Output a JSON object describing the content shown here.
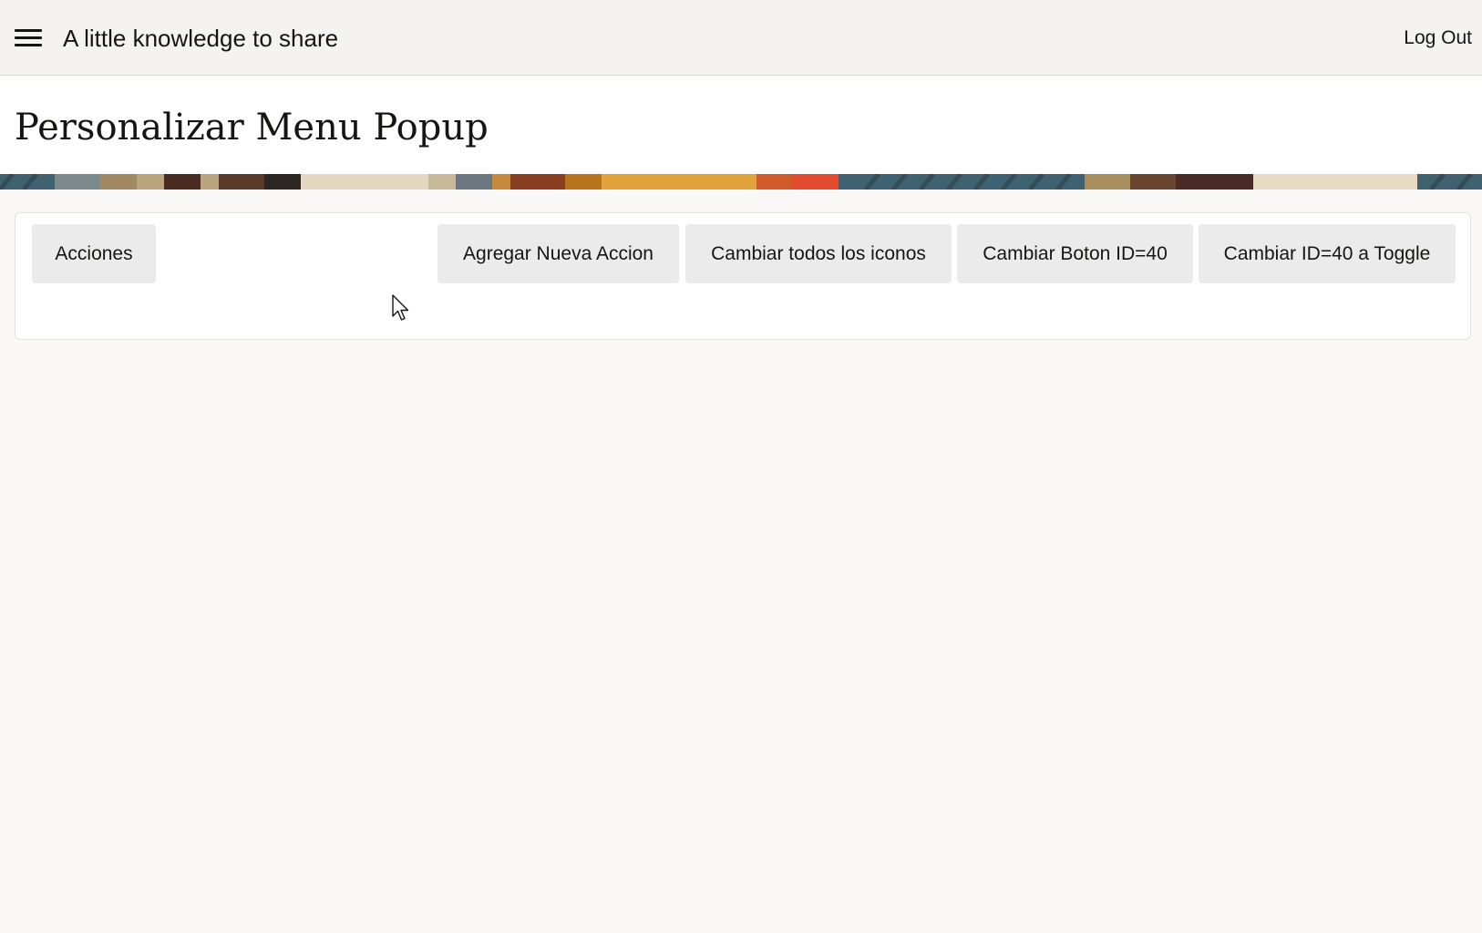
{
  "header": {
    "app_title": "A little knowledge to share",
    "logout_label": "Log Out",
    "menu_icon": "hamburger-menu-icon"
  },
  "page": {
    "title": "Personalizar Menu Popup"
  },
  "toolbar": {
    "acciones_label": "Acciones",
    "agregar_label": "Agregar Nueva Accion",
    "cambiar_iconos_label": "Cambiar todos los iconos",
    "cambiar_boton_label": "Cambiar Boton ID=40",
    "toggle_label": "Cambiar ID=40 a Toggle"
  },
  "colors": {
    "topbar_bg": "#f4f3f1",
    "page_bg": "#f9f8f6",
    "button_bg": "#ebebeb",
    "text": "#161513"
  }
}
